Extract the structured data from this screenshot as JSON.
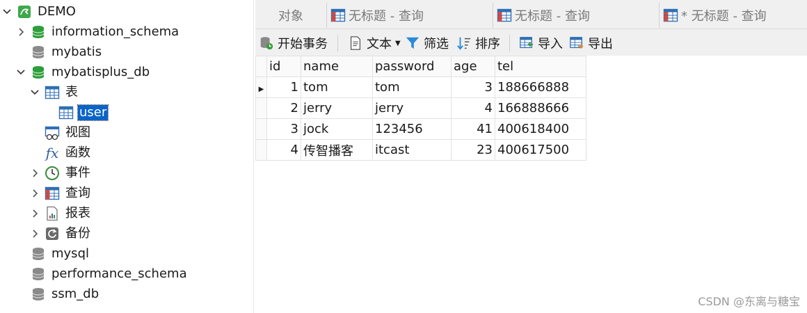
{
  "sidebar": {
    "connection": "DEMO",
    "databases": [
      "information_schema",
      "mybatis",
      "mybatisplus_db"
    ],
    "open_db_children": {
      "tables": "表",
      "table_items": [
        "user"
      ],
      "views": "视图",
      "functions": "函数",
      "events": "事件",
      "queries": "查询",
      "reports": "报表",
      "backups": "备份"
    },
    "more_databases": [
      "mysql",
      "performance_schema",
      "ssm_db"
    ]
  },
  "tabs": {
    "objects": "对象",
    "query1": "无标题 - 查询",
    "query2": "无标题 - 查询",
    "query3": "* 无标题 - 查询"
  },
  "toolbar": {
    "begin_transaction": "开始事务",
    "text": "文本",
    "filter": "筛选",
    "sort": "排序",
    "import": "导入",
    "export": "导出"
  },
  "grid": {
    "columns": [
      "id",
      "name",
      "password",
      "age",
      "tel"
    ],
    "rows": [
      [
        "1",
        "tom",
        "tom",
        "3",
        "188666888"
      ],
      [
        "2",
        "jerry",
        "jerry",
        "4",
        "166888666"
      ],
      [
        "3",
        "jock",
        "123456",
        "41",
        "400618400"
      ],
      [
        "4",
        "传智播客",
        "itcast",
        "23",
        "400617500"
      ]
    ]
  },
  "watermark": "CSDN @东离与糖宝",
  "colors": {
    "db_green": "#2e9e3a",
    "db_gray": "#8a8a8a",
    "selection": "#0a64c8"
  }
}
